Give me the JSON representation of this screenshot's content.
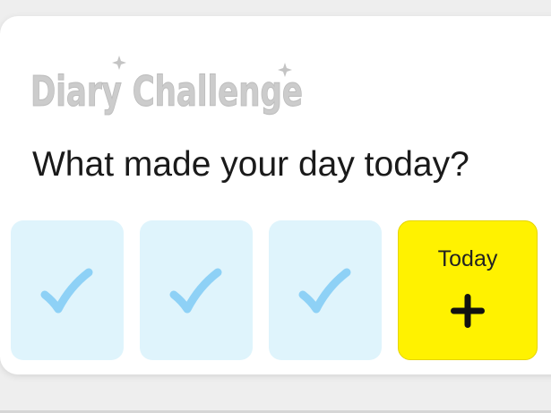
{
  "widget": {
    "logo_text": "Diary Challenge",
    "question": "What made your day today?",
    "completed_days": [
      {
        "icon": "checkmark-icon",
        "status": "done"
      },
      {
        "icon": "checkmark-icon",
        "status": "done"
      },
      {
        "icon": "checkmark-icon",
        "status": "done"
      }
    ],
    "today": {
      "label": "Today",
      "icon": "plus-icon"
    }
  },
  "colors": {
    "card_background": "#ffffff",
    "completed_tile": "#dff4fc",
    "checkmark": "#8ed1f6",
    "today_tile": "#fff200",
    "logo": "#c4c4c4",
    "question_text": "#1a1a1a"
  }
}
